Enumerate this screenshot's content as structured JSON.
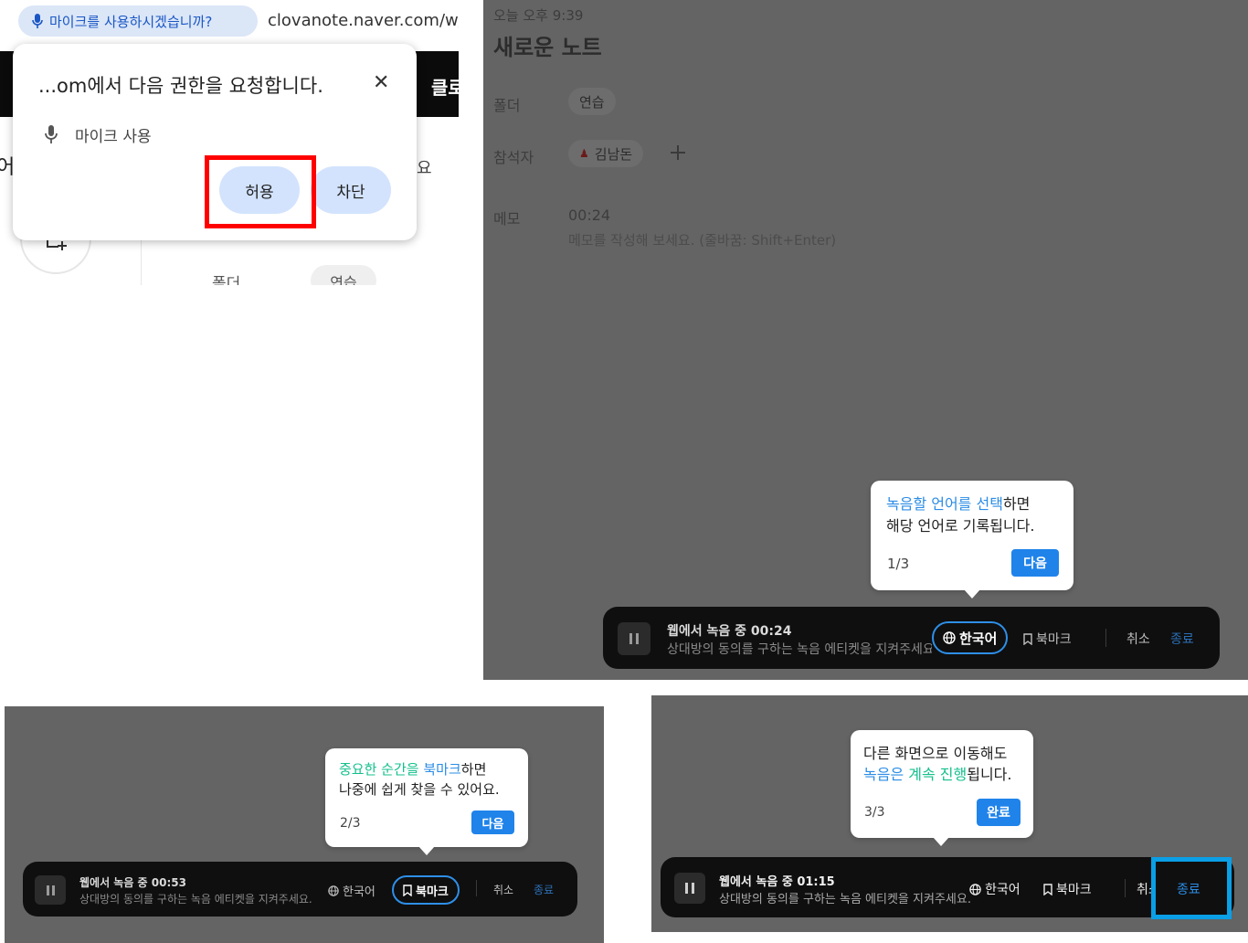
{
  "panel1": {
    "address_chip": "마이크를 사용하시겠습니까?",
    "url": "clovanote.naver.com/w/",
    "black_bar_text": "클로",
    "left_partial_char": "어",
    "right_partial_char": "요",
    "folder_label": "폴더",
    "folder_pill": "연습",
    "dialog": {
      "title": "...om에서 다음 권한을 요청합니다.",
      "close": "✕",
      "permission": "마이크 사용",
      "allow": "허용",
      "block": "차단"
    }
  },
  "panel2": {
    "timestamp": "오늘 오후 9:39",
    "note_title": "새로운 노트",
    "folder_label": "폴더",
    "folder_value": "연습",
    "attendee_label": "참석자",
    "attendee_name": "김남돈",
    "memo_label": "메모",
    "memo_time": "00:24",
    "memo_placeholder": "메모를 작성해 보세요. (줄바꿈: Shift+Enter)",
    "tooltip": {
      "line1_highlight": "녹음할 언어를 선택",
      "line1_rest": "하면",
      "line2": "해당 언어로 기록됩니다.",
      "step": "1/3",
      "button": "다음"
    },
    "recorder": {
      "status": "웹에서 녹음 중 00:24",
      "subtitle": "상대방의 동의를 구하는 녹음 에티켓을 지켜주세요.",
      "language": "한국어",
      "bookmark": "북마크",
      "cancel": "취소",
      "end": "종료"
    }
  },
  "panel3": {
    "tooltip": {
      "hl1": "중요한 순간을",
      "hl2": "북마크",
      "line1_rest": "하면",
      "line2": "나중에 쉽게 찾을 수 있어요.",
      "step": "2/3",
      "button": "다음"
    },
    "recorder": {
      "status": "웹에서 녹음 중 00:53",
      "subtitle": "상대방의 동의를 구하는 녹음 에티켓을 지켜주세요.",
      "language": "한국어",
      "bookmark": "북마크",
      "cancel": "취소",
      "end": "종료"
    }
  },
  "panel4": {
    "tooltip": {
      "line1": "다른 화면으로 이동해도",
      "hl1": "녹음은",
      "hl2": "계속 진행",
      "line2_rest": "됩니다.",
      "step": "3/3",
      "button": "완료"
    },
    "recorder": {
      "status": "웹에서 녹음 중 01:15",
      "subtitle": "상대방의 동의를 구하는 녹음 에티켓을 지켜주세요.",
      "language": "한국어",
      "bookmark": "북마크",
      "cancel": "취소",
      "end": "종료"
    }
  },
  "colors": {
    "highlight_red": "#ff0000",
    "highlight_cyan": "#0a9fe6",
    "accent_blue": "#1f83ea",
    "accent_green": "#14c08c",
    "overlay_gray": "#646464"
  }
}
